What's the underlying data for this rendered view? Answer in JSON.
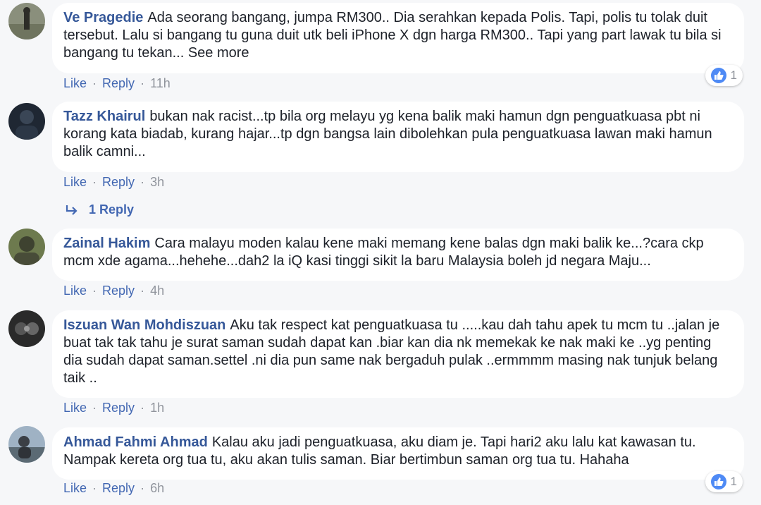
{
  "comments": [
    {
      "name": "Ve Pragedie",
      "text": "Ada seorang bangang, jumpa RM300.. Dia serahkan kepada Polis. Tapi, polis tu tolak duit tersebut. Lalu si bangang tu guna duit utk beli iPhone X dgn harga RM300.. Tapi yang part lawak tu bila si bangang tu tekan...",
      "see_more": "See more",
      "like": "Like",
      "reply": "Reply",
      "time": "11h",
      "reaction_count": "1"
    },
    {
      "name": "Tazz Khairul",
      "text": "bukan nak racist...tp bila org melayu yg kena balik maki hamun dgn penguatkuasa pbt ni korang kata biadab, kurang hajar...tp dgn bangsa lain dibolehkan pula penguatkuasa lawan maki hamun balik camni...",
      "like": "Like",
      "reply": "Reply",
      "time": "3h",
      "replies_label": "1 Reply"
    },
    {
      "name": "Zainal Hakim",
      "text": "Cara malayu moden kalau kene maki memang kene balas dgn maki balik ke...?cara ckp mcm xde agama...hehehe...dah2 la iQ kasi tinggi sikit la baru Malaysia boleh jd negara Maju...",
      "like": "Like",
      "reply": "Reply",
      "time": "4h"
    },
    {
      "name": "Iszuan Wan Mohdiszuan",
      "text": "Aku tak respect kat penguatkuasa tu .....kau dah tahu apek tu mcm tu ..jalan je buat tak tak tahu je surat saman sudah dapat kan .biar kan dia nk memekak ke nak maki ke ..yg penting dia sudah dapat saman.settel .ni dia pun same nak bergaduh pulak ..ermmmm masing nak tunjuk belang taik ..",
      "like": "Like",
      "reply": "Reply",
      "time": "1h"
    },
    {
      "name": "Ahmad Fahmi Ahmad",
      "text": "Kalau aku jadi penguatkuasa, aku diam je. Tapi hari2 aku lalu kat kawasan tu. Nampak kereta org tua tu, aku akan tulis saman. Biar bertimbun saman org tua tu. Hahaha",
      "like": "Like",
      "reply": "Reply",
      "time": "6h",
      "reaction_count": "1"
    }
  ],
  "separator": "·",
  "colors": {
    "name": "#365899",
    "link": "#4267b2",
    "meta": "#90949c",
    "bubble": "#ffffff",
    "background": "#f6f7f9",
    "like_reaction": "#4e8af5"
  },
  "icons": {
    "reaction": "thumbs-up-icon",
    "reply_arrow": "reply-arrow-icon"
  }
}
